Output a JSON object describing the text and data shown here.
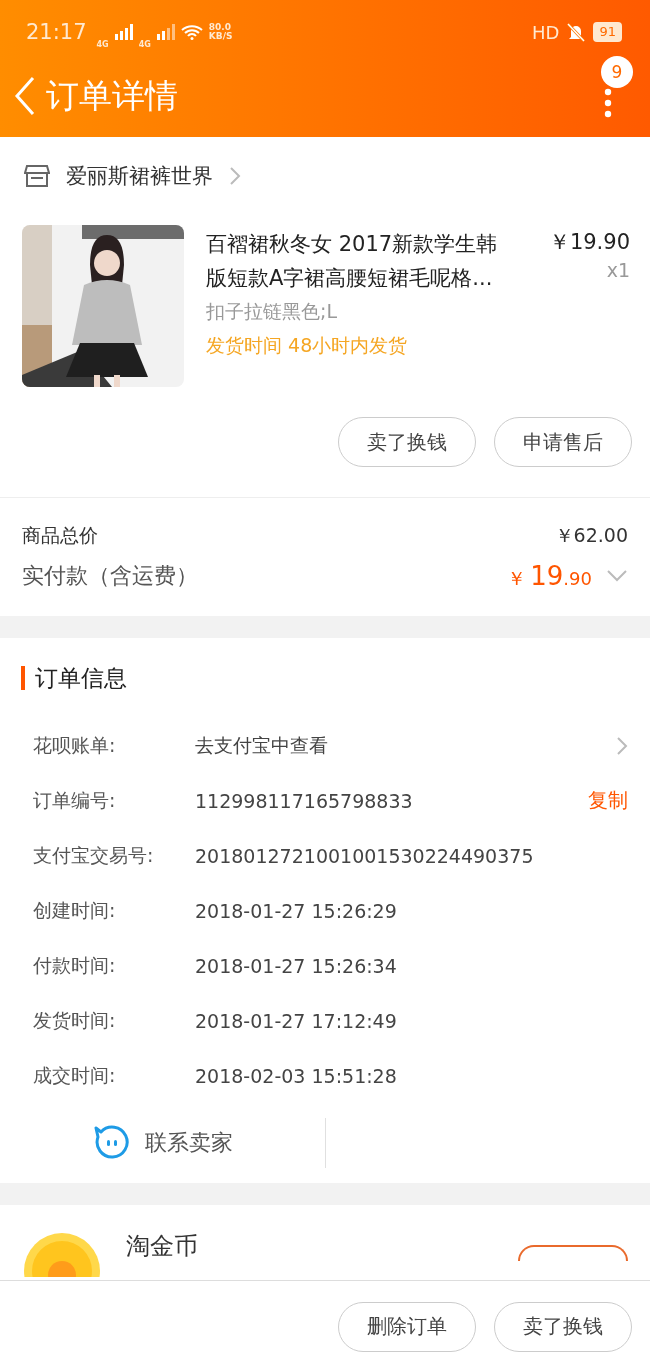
{
  "status_bar": {
    "time": "21:17",
    "network_1": "4G",
    "network_2": "4G",
    "speed": "80.0",
    "speed_unit": "KB/S",
    "hd": "HD",
    "battery": "91"
  },
  "header": {
    "title": "订单详情",
    "badge": "9"
  },
  "shop": {
    "name": "爱丽斯裙裤世界"
  },
  "product": {
    "title": "百褶裙秋冬女 2017新款学生韩版短款A字裙高腰短裙毛呢格...",
    "price": "￥19.90",
    "quantity": "x1",
    "sku": "扣子拉链黑色;L",
    "shipping_label": "发货时间",
    "shipping_value": "48小时内发货"
  },
  "product_actions": [
    "卖了换钱",
    "申请售后"
  ],
  "totals": {
    "goods_label": "商品总价",
    "goods_value": "￥62.00",
    "paid_label": "实付款（含运费）",
    "paid_currency": "￥",
    "paid_integer": "19",
    "paid_decimal": ".90"
  },
  "order_info": {
    "title": "订单信息",
    "rows": [
      {
        "kind": "link",
        "label": "花呗账单:",
        "value": "去支付宝中查看"
      },
      {
        "kind": "copy",
        "label": "订单编号:",
        "value": "112998117165798833",
        "action": "复制"
      },
      {
        "kind": "plain",
        "label": "支付宝交易号:",
        "value": "2018012721001001530224490375"
      },
      {
        "kind": "plain",
        "label": "创建时间:",
        "value": "2018-01-27 15:26:29"
      },
      {
        "kind": "plain",
        "label": "付款时间:",
        "value": "2018-01-27 15:26:34"
      },
      {
        "kind": "plain",
        "label": "发货时间:",
        "value": "2018-01-27 17:12:49"
      },
      {
        "kind": "plain",
        "label": "成交时间:",
        "value": "2018-02-03 15:51:28"
      }
    ]
  },
  "contact": {
    "label": "联系卖家"
  },
  "coins": {
    "title": "淘金币"
  },
  "bottom_actions": [
    "删除订单",
    "卖了换钱"
  ]
}
